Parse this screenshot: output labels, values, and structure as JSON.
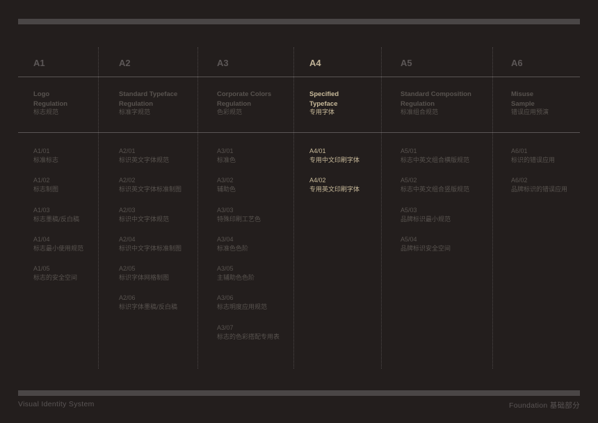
{
  "columns": [
    {
      "code": "A1",
      "title_lines": [
        "Logo",
        "Regulation"
      ],
      "title_cn": "标志规范",
      "items": [
        {
          "code": "A1/01",
          "label": "标准标志"
        },
        {
          "code": "A1/02",
          "label": "标志制图"
        },
        {
          "code": "A1/03",
          "label": "标志墨稿/反白稿"
        },
        {
          "code": "A1/04",
          "label": "标志最小使用规范"
        },
        {
          "code": "A1/05",
          "label": "标志的安全空间"
        }
      ]
    },
    {
      "code": "A2",
      "title_lines": [
        "Standard Typeface",
        "Regulation"
      ],
      "title_cn": "标准字规范",
      "items": [
        {
          "code": "A2/01",
          "label": "标识英文字体规范"
        },
        {
          "code": "A2/02",
          "label": "标识英文字体标准制图"
        },
        {
          "code": "A2/03",
          "label": "标识中文字体规范"
        },
        {
          "code": "A2/04",
          "label": "标识中文字体标准制图"
        },
        {
          "code": "A2/05",
          "label": "标识字体网格制图"
        },
        {
          "code": "A2/06",
          "label": "标识字体墨稿/反白稿"
        }
      ]
    },
    {
      "code": "A3",
      "title_lines": [
        "Corporate Colors",
        "Regulation"
      ],
      "title_cn": "色彩规范",
      "items": [
        {
          "code": "A3/01",
          "label": "标准色"
        },
        {
          "code": "A3/02",
          "label": "辅助色"
        },
        {
          "code": "A3/03",
          "label": "特殊印刷工艺色"
        },
        {
          "code": "A3/04",
          "label": "标准色色阶"
        },
        {
          "code": "A3/05",
          "label": "主辅助色色阶"
        },
        {
          "code": "A3/06",
          "label": "标志明度应用规范"
        },
        {
          "code": "A3/07",
          "label": "标志的色彩搭配专用表"
        }
      ]
    },
    {
      "code": "A4",
      "active": true,
      "title_lines": [
        "Specified",
        "Typeface"
      ],
      "title_cn": "专用字体",
      "items": [
        {
          "code": "A4/01",
          "label": "专用中文印刷字体"
        },
        {
          "code": "A4/02",
          "label": "专用英文印刷字体"
        }
      ]
    },
    {
      "code": "A5",
      "title_lines": [
        "Standard Composition",
        "Regulation"
      ],
      "title_cn": "标准组合规范",
      "items": [
        {
          "code": "A5/01",
          "label": "标志中英文组合横版规范"
        },
        {
          "code": "A5/02",
          "label": "标志中英文组合竖版规范"
        },
        {
          "code": "A5/03",
          "label": "品牌标识最小规范"
        },
        {
          "code": "A5/04",
          "label": "品牌标识安全空间"
        }
      ]
    },
    {
      "code": "A6",
      "title_lines": [
        "Misuse",
        "Sample"
      ],
      "title_cn": "错误应用预演",
      "items": [
        {
          "code": "A6/01",
          "label": "标识的错误应用"
        },
        {
          "code": "A6/02",
          "label": "品牌标识的错误应用"
        }
      ]
    }
  ],
  "footer": {
    "left": "Visual Identity System",
    "right_en": "Foundation",
    "right_cn": "基础部分"
  },
  "colors": {
    "background": "#231e1d",
    "muted_text": "#58534f",
    "active_text": "#c9bb9b",
    "bar": "#4a4646"
  }
}
